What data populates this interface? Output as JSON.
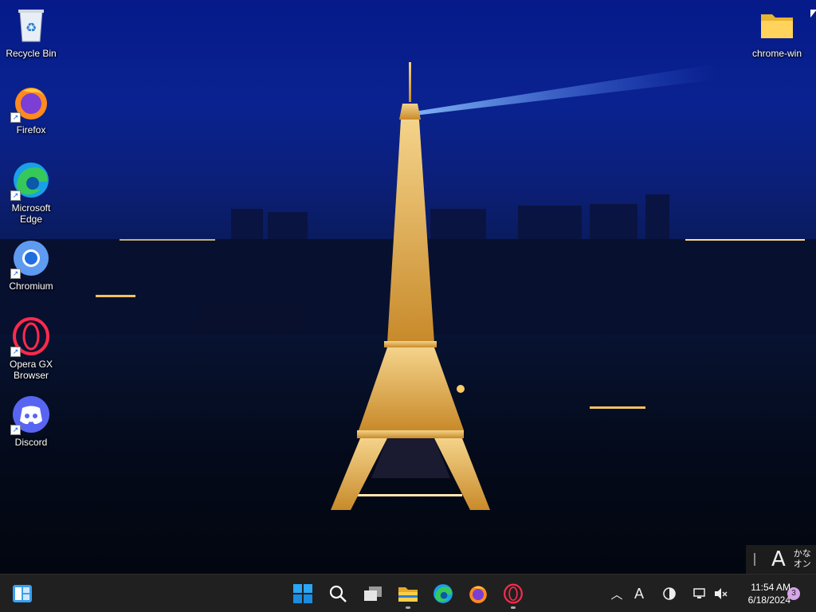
{
  "desktop": {
    "icons": [
      {
        "label": "Recycle Bin",
        "icon": "recycle-bin-icon"
      },
      {
        "label": "Firefox",
        "icon": "firefox-icon"
      },
      {
        "label": "Microsoft\nEdge",
        "icon": "edge-icon"
      },
      {
        "label": "Chromium",
        "icon": "chromium-icon"
      },
      {
        "label": "Opera GX\nBrowser",
        "icon": "opera-gx-icon"
      },
      {
        "label": "Discord",
        "icon": "discord-icon"
      },
      {
        "label": "chrome-win",
        "icon": "folder-icon"
      }
    ]
  },
  "ime": {
    "mode_char": "A",
    "kana_line1": "かな",
    "kana_line2": "オン"
  },
  "taskbar": {
    "pinned": [
      {
        "name": "widgets-icon"
      },
      {
        "name": "start-icon"
      },
      {
        "name": "search-icon"
      },
      {
        "name": "task-view-icon"
      },
      {
        "name": "file-explorer-icon"
      },
      {
        "name": "edge-icon"
      },
      {
        "name": "firefox-icon"
      },
      {
        "name": "opera-icon"
      }
    ],
    "tray": {
      "ime_char": "A",
      "time": "11:54 AM",
      "date": "6/18/2024",
      "notification_count": "3"
    }
  },
  "colors": {
    "taskbar_bg": "#202020",
    "accent_blue": "#0078d4",
    "wallpaper_sky": "#0a2290"
  }
}
